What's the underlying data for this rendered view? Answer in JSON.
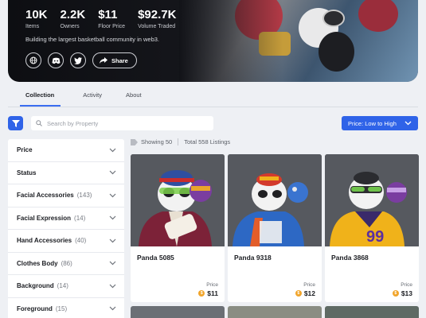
{
  "hero": {
    "stats": [
      {
        "value": "10K",
        "label": "Items"
      },
      {
        "value": "2.2K",
        "label": "Owners"
      },
      {
        "value": "$11",
        "label": "Floor Price"
      },
      {
        "value": "$92.7K",
        "label": "Volume Traded"
      }
    ],
    "tagline": "Building the largest basketball community in web3.",
    "share_label": "Share",
    "icons": [
      "globe-icon",
      "discord-icon",
      "twitter-icon",
      "share-icon"
    ]
  },
  "tabs": [
    "Collection",
    "Activity",
    "About"
  ],
  "active_tab": "Collection",
  "toolbar": {
    "search_placeholder": "Search by Property",
    "sort_label": "Price: Low to High"
  },
  "filters": [
    {
      "label": "Price",
      "count": ""
    },
    {
      "label": "Status",
      "count": ""
    },
    {
      "label": "Facial Accessories",
      "count": "(143)"
    },
    {
      "label": "Facial Expression",
      "count": "(14)"
    },
    {
      "label": "Hand Accessories",
      "count": "(40)"
    },
    {
      "label": "Clothes Body",
      "count": "(86)"
    },
    {
      "label": "Background",
      "count": "(14)"
    },
    {
      "label": "Foreground",
      "count": "(15)"
    }
  ],
  "listing": {
    "showing": "Showing 50",
    "total": "Total 558 Listings"
  },
  "cards": [
    {
      "name": "Panda 5085",
      "price_label": "Price",
      "price": "$11",
      "jersey": "",
      "shirt_color": "#7c2238"
    },
    {
      "name": "Panda 9318",
      "price_label": "Price",
      "price": "$12",
      "jersey": "",
      "shirt_color": "#2d68c4"
    },
    {
      "name": "Panda 3868",
      "price_label": "Price",
      "price": "$13",
      "jersey": "99",
      "shirt_color": "#f0b21a"
    }
  ],
  "colors": {
    "accent": "#2f63e8",
    "coin": "#f1a52c"
  }
}
